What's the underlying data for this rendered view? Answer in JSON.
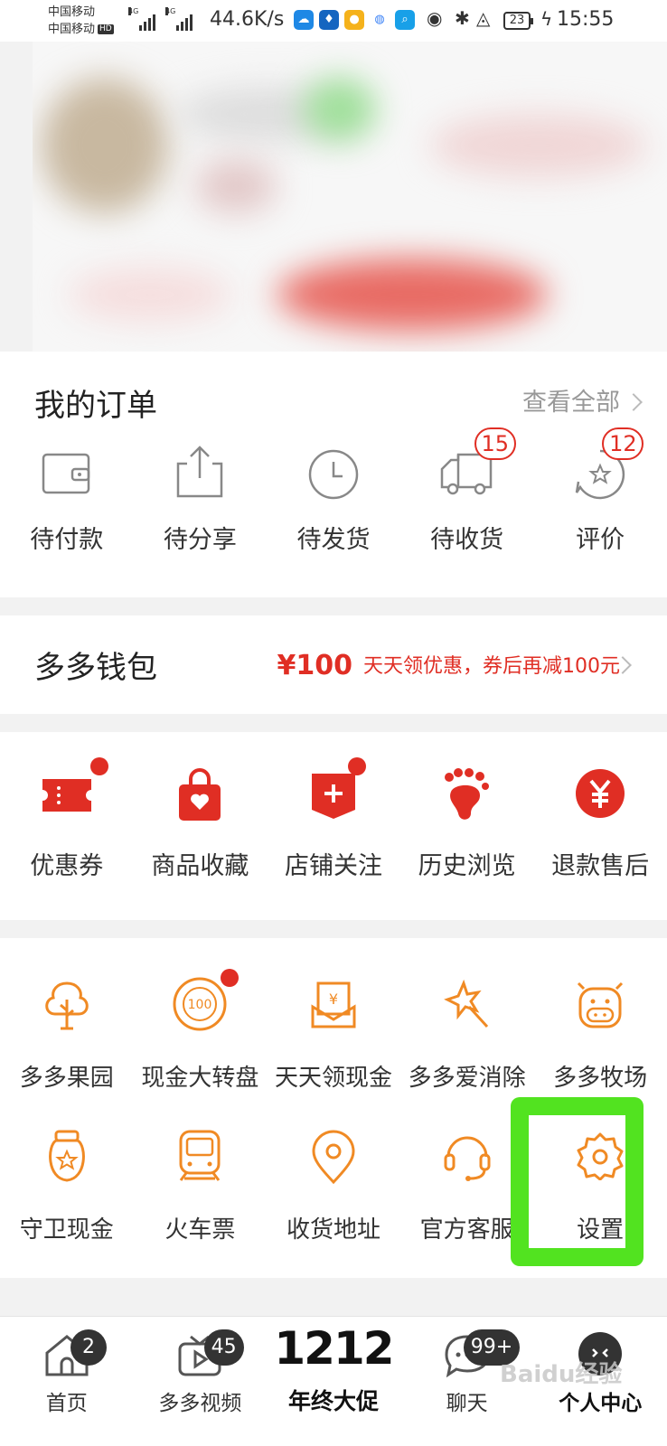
{
  "status_bar": {
    "carrier_1": "中国移动",
    "carrier_2": "中国移动",
    "hd": "HD",
    "net_tag": "4G",
    "speed": "44.6K/s",
    "battery": "23",
    "time": "15:55"
  },
  "orders": {
    "title": "我的订单",
    "see_all": "查看全部",
    "items": [
      {
        "label": "待付款",
        "icon": "wallet-icon"
      },
      {
        "label": "待分享",
        "icon": "share-icon"
      },
      {
        "label": "待发货",
        "icon": "clock-icon"
      },
      {
        "label": "待收货",
        "icon": "truck-icon",
        "badge": "15"
      },
      {
        "label": "评价",
        "icon": "review-star-icon",
        "badge": "12"
      }
    ]
  },
  "wallet": {
    "title": "多多钱包",
    "amount": "¥100",
    "promo": "天天领优惠，券后再减100元"
  },
  "shortcuts": {
    "items": [
      {
        "label": "优惠券",
        "icon": "coupon-icon",
        "dot": true
      },
      {
        "label": "商品收藏",
        "icon": "favorite-bag-icon"
      },
      {
        "label": "店铺关注",
        "icon": "store-follow-icon",
        "dot": true
      },
      {
        "label": "历史浏览",
        "icon": "footprint-icon"
      },
      {
        "label": "退款售后",
        "icon": "refund-yen-icon"
      }
    ]
  },
  "services": {
    "row1": [
      {
        "label": "多多果园",
        "icon": "tree-icon"
      },
      {
        "label": "现金大转盘",
        "icon": "wheel-100-icon",
        "dot": true
      },
      {
        "label": "天天领现金",
        "icon": "cash-envelope-icon"
      },
      {
        "label": "多多爱消除",
        "icon": "star-wand-icon"
      },
      {
        "label": "多多牧场",
        "icon": "cow-icon"
      }
    ],
    "row2": [
      {
        "label": "守卫现金",
        "icon": "cash-jar-icon"
      },
      {
        "label": "火车票",
        "icon": "train-icon"
      },
      {
        "label": "收货地址",
        "icon": "location-pin-icon"
      },
      {
        "label": "官方客服",
        "icon": "headset-icon"
      },
      {
        "label": "设置",
        "icon": "gear-icon"
      }
    ],
    "wheel_text": "100",
    "cash_text": "¥"
  },
  "bottom_nav": {
    "items": [
      {
        "label": "首页",
        "badge": "2"
      },
      {
        "label": "多多视频",
        "badge": "45"
      },
      {
        "label": "年终大促",
        "big": "1212"
      },
      {
        "label": "聊天",
        "badge": "99+"
      },
      {
        "label": "个人中心"
      }
    ]
  },
  "watermark": "Baidu经验",
  "colors": {
    "accent": "#e02e24",
    "service_orange": "#f08a24",
    "highlight": "#52e320"
  }
}
